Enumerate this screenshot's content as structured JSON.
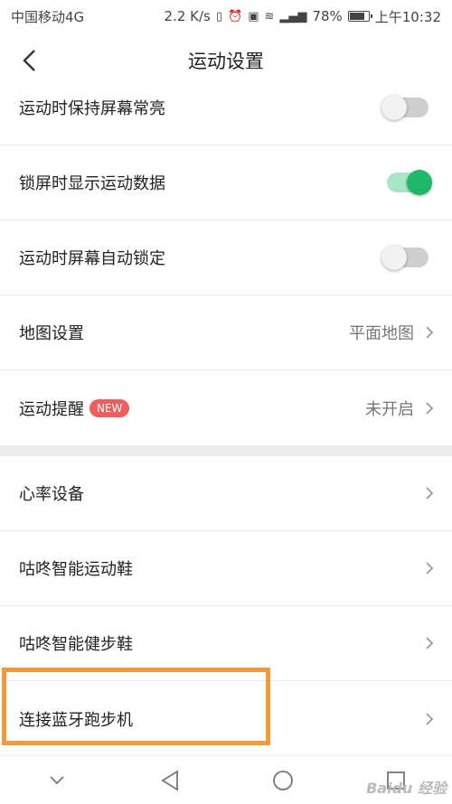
{
  "status_bar": {
    "carrier": "中国移动4G",
    "speed": "2.2 K/s",
    "battery": "78%",
    "time": "上午10:32"
  },
  "header": {
    "title": "运动设置"
  },
  "section1": [
    {
      "label": "运动时保持屏幕常亮",
      "type": "toggle",
      "on": false
    },
    {
      "label": "锁屏时显示运动数据",
      "type": "toggle",
      "on": true
    },
    {
      "label": "运动时屏幕自动锁定",
      "type": "toggle",
      "on": false
    },
    {
      "label": "地图设置",
      "type": "value",
      "value": "平面地图"
    },
    {
      "label": "运动提醒",
      "type": "value",
      "badge": "NEW",
      "value": "未开启"
    }
  ],
  "section2": [
    {
      "label": "心率设备"
    },
    {
      "label": "咕咚智能运动鞋"
    },
    {
      "label": "咕咚智能健步鞋"
    },
    {
      "label": "连接蓝牙跑步机"
    }
  ],
  "watermark": "Baidu 经验",
  "colors": {
    "accent": "#1db86a",
    "badge": "#f05d5d",
    "highlight": "#f59a3c"
  }
}
